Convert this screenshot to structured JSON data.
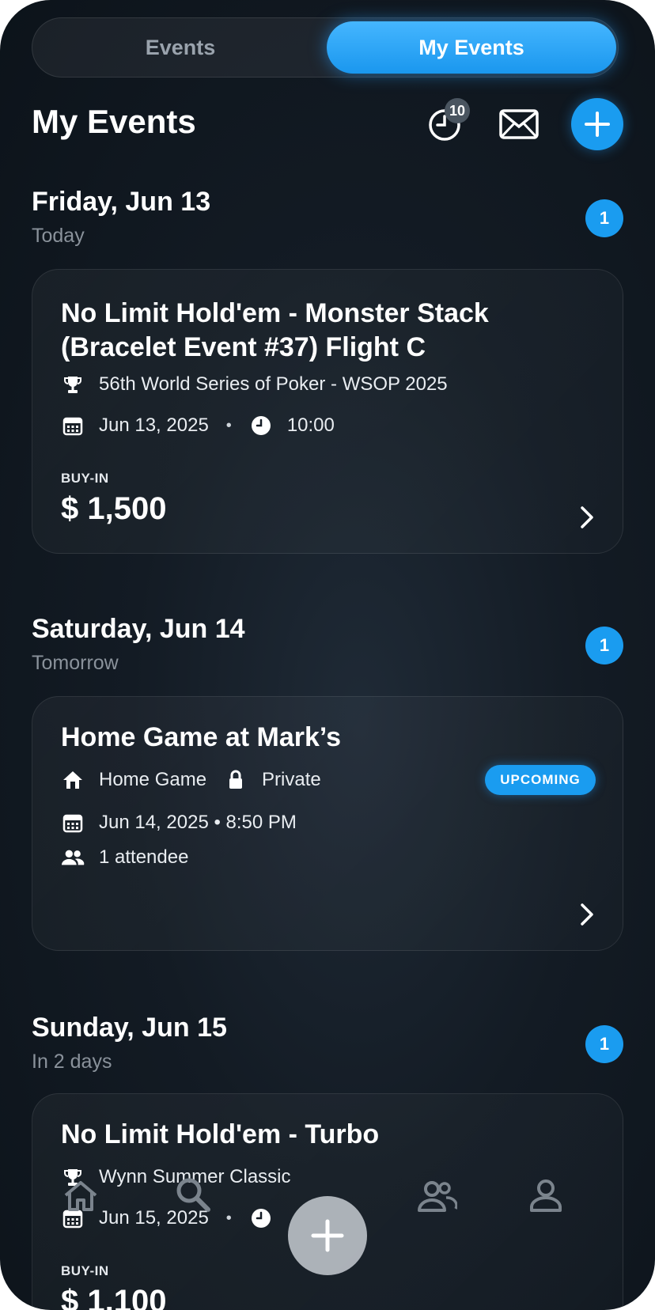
{
  "segment": {
    "events_label": "Events",
    "my_events_label": "My Events"
  },
  "header": {
    "title": "My Events",
    "history_badge": "10"
  },
  "days": [
    {
      "title": "Friday, Jun 13",
      "subtitle": "Today",
      "count": "1",
      "event": {
        "title": "No Limit Hold'em - Monster Stack (Bracelet Event #37) Flight C",
        "series": "56th World Series of Poker - WSOP 2025",
        "date": "Jun 13, 2025",
        "time": "10:00",
        "buyin_label": "BUY-IN",
        "buyin": "$ 1,500"
      }
    },
    {
      "title": "Saturday, Jun 14",
      "subtitle": "Tomorrow",
      "count": "1",
      "event": {
        "title": "Home Game at Mark’s",
        "type": "Home Game",
        "privacy": "Private",
        "status": "UPCOMING",
        "datetime": "Jun 14, 2025 • 8:50 PM",
        "attendees": "1 attendee"
      }
    },
    {
      "title": "Sunday, Jun 15",
      "subtitle": "In 2 days",
      "count": "1",
      "event": {
        "title": "No Limit Hold'em - Turbo",
        "series": "Wynn Summer Classic",
        "date": "Jun 15, 2025",
        "buyin_label": "BUY-IN",
        "buyin": "$ 1,100"
      }
    }
  ],
  "colors": {
    "accent": "#1a9cf0",
    "background": "#131b24"
  },
  "tabbar": {
    "items": [
      "home-icon",
      "search-icon",
      "add-icon",
      "people-icon",
      "profile-icon"
    ]
  }
}
